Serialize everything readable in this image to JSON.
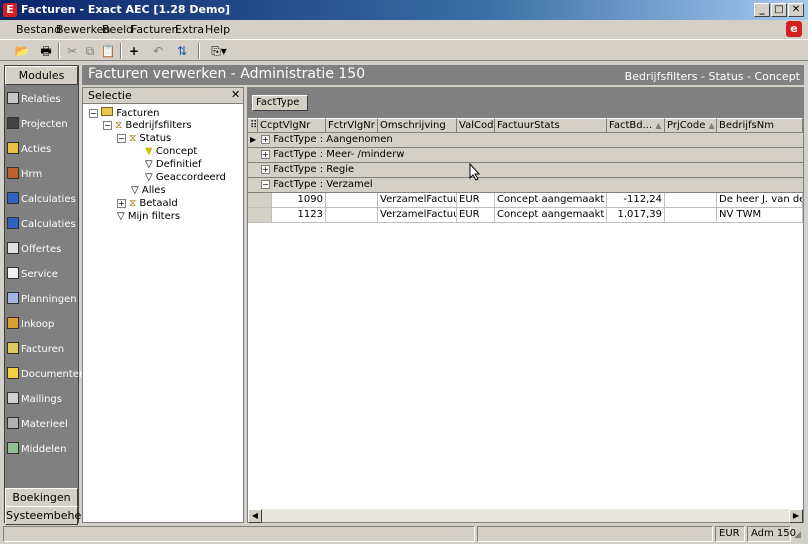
{
  "window": {
    "title": "Facturen - Exact AEC [1.28 Demo]",
    "min": "_",
    "max": "□",
    "close": "✕"
  },
  "menu": [
    "Bestand",
    "Bewerken",
    "Beeld",
    "Facturen",
    "Extra",
    "Help"
  ],
  "nav": {
    "top": "Modules",
    "items": [
      "Relaties",
      "Projecten",
      "Acties",
      "Hrm",
      "Calculaties",
      "Calculaties",
      "Offertes",
      "Service",
      "Planningen",
      "Inkoop",
      "Facturen",
      "Documenten",
      "Mailings",
      "Materieel",
      "Middelen"
    ],
    "bottom1": "Boekingen",
    "bottom2": "Systeembeheer"
  },
  "header": {
    "title": "Facturen verwerken - Administratie 150",
    "filters": "Bedrijfsfilters - Status - Concept"
  },
  "selectie": {
    "title": "Selectie",
    "close": "✕",
    "tree": [
      "Facturen",
      "Bedrijfsfilters",
      "Status",
      "Concept",
      "Definitief",
      "Geaccordeerd",
      "Alles",
      "Betaald",
      "Mijn filters"
    ]
  },
  "grid": {
    "group_chip": "FactType",
    "columns": [
      "CcptVlgNr",
      "FctrVlgNr",
      "Omschrijving",
      "ValCode",
      "FactuurStats",
      "FactBd...",
      "PrjCode",
      "BedrijfsNm"
    ],
    "groups": [
      "FactType : Aangenomen",
      "FactType : Meer- /minderw",
      "FactType : Regie",
      "FactType : Verzamel"
    ],
    "rows": [
      [
        "1090",
        "",
        "VerzamelFactuur",
        "EUR",
        "Concept aangemaakt",
        "-112,24",
        "",
        "De heer J. van der Gr"
      ],
      [
        "1123",
        "",
        "VerzamelFactuur",
        "EUR",
        "Concept aangemaakt",
        "1.017,39",
        "",
        "NV TWM"
      ]
    ]
  },
  "status": {
    "currency": "EUR",
    "admin": "Adm 150"
  }
}
